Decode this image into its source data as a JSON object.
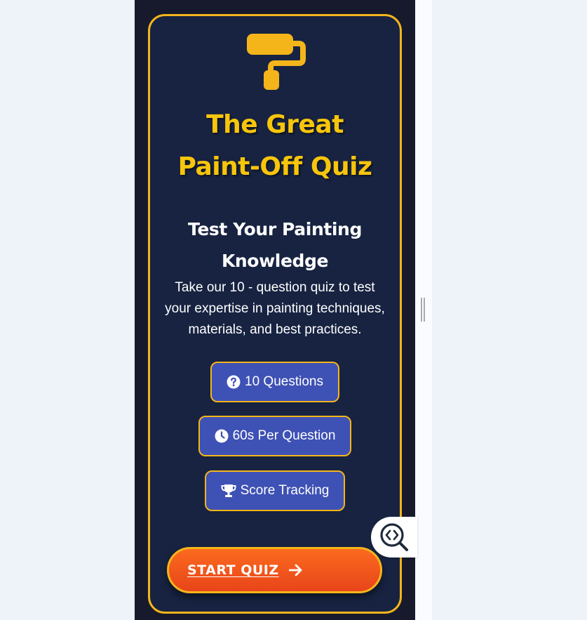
{
  "header": {
    "title_line1": "The Great",
    "title_line2": "Paint-Off Quiz",
    "icon": "paint-roller-icon"
  },
  "intro": {
    "subtitle_line1": "Test Your Painting",
    "subtitle_line2": "Knowledge",
    "description": "Take our 10 - question quiz to test your expertise in painting techniques, materials, and best practices."
  },
  "features": [
    {
      "label": "10 Questions",
      "icon": "question-circle-icon"
    },
    {
      "label": "60s Per Question",
      "icon": "clock-icon"
    },
    {
      "label": "Score Tracking",
      "icon": "trophy-icon"
    }
  ],
  "actions": {
    "start_label": "START QUIZ",
    "start_icon": "arrow-right-icon"
  },
  "overlay": {
    "inspector_icon": "code-search-icon"
  },
  "colors": {
    "page_bg": "#171a2d",
    "card_bg": "#172341",
    "accent": "#f4b51b",
    "title": "#f7c50c",
    "pill_bg": "#3e51b5",
    "button_start": "#fb6a1e",
    "button_end": "#e8451a"
  }
}
